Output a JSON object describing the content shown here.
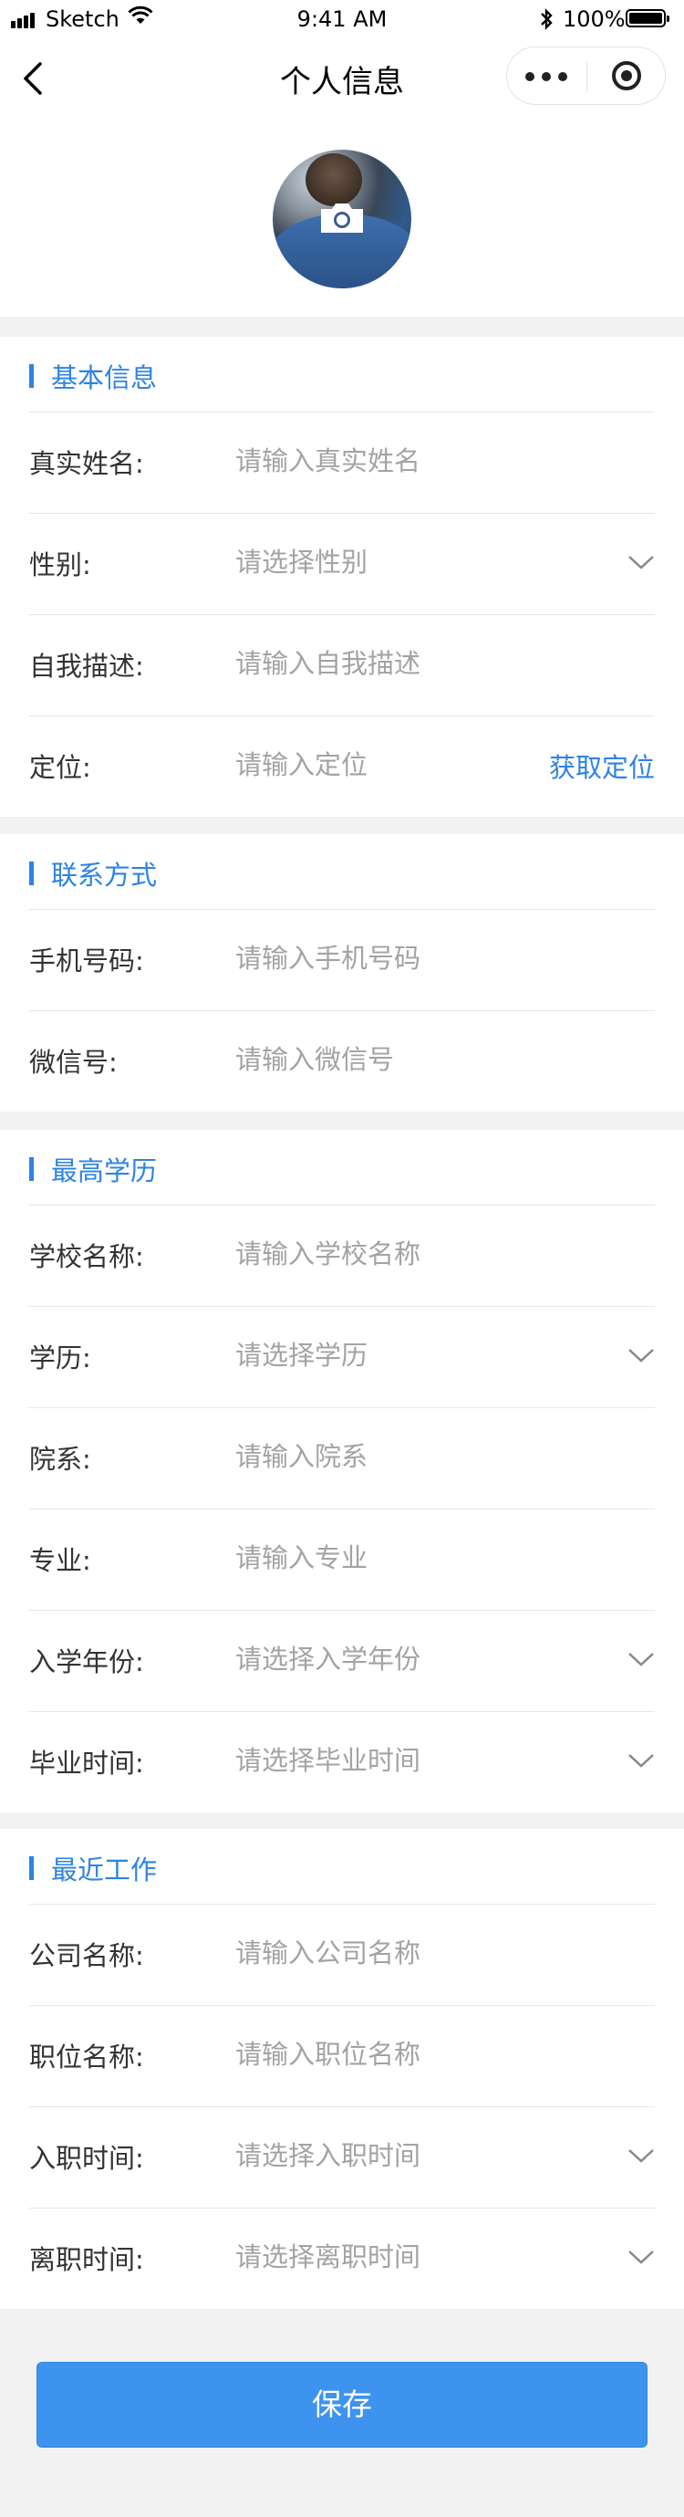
{
  "status_bar": {
    "carrier": "Sketch",
    "time": "9:41 AM",
    "battery": "100%"
  },
  "nav": {
    "title": "个人信息"
  },
  "sections": {
    "basic": {
      "title": "基本信息",
      "fields": [
        {
          "label": "真实姓名:",
          "placeholder": "请输入真实姓名"
        },
        {
          "label": "性别:",
          "placeholder": "请选择性别"
        },
        {
          "label": "自我描述:",
          "placeholder": "请输入自我描述"
        },
        {
          "label": "定位:",
          "placeholder": "请输入定位",
          "action": "获取定位"
        }
      ]
    },
    "contact": {
      "title": "联系方式",
      "fields": [
        {
          "label": "手机号码:",
          "placeholder": "请输入手机号码"
        },
        {
          "label": "微信号:",
          "placeholder": "请输入微信号"
        }
      ]
    },
    "education": {
      "title": "最高学历",
      "fields": [
        {
          "label": "学校名称:",
          "placeholder": "请输入学校名称"
        },
        {
          "label": "学历:",
          "placeholder": "请选择学历"
        },
        {
          "label": "院系:",
          "placeholder": "请输入院系"
        },
        {
          "label": "专业:",
          "placeholder": "请输入专业"
        },
        {
          "label": "入学年份:",
          "placeholder": "请选择入学年份"
        },
        {
          "label": "毕业时间:",
          "placeholder": "请选择毕业时间"
        }
      ]
    },
    "work": {
      "title": "最近工作",
      "fields": [
        {
          "label": "公司名称:",
          "placeholder": "请输入公司名称"
        },
        {
          "label": "职位名称:",
          "placeholder": "请输入职位名称"
        },
        {
          "label": "入职时间:",
          "placeholder": "请选择入职时间"
        },
        {
          "label": "离职时间:",
          "placeholder": "请选择离职时间"
        }
      ]
    }
  },
  "save_label": "保存",
  "colors": {
    "accent": "#2d83e3",
    "button": "#3d93ee",
    "background": "#f2f2f2",
    "placeholder": "#a3a3a3"
  }
}
